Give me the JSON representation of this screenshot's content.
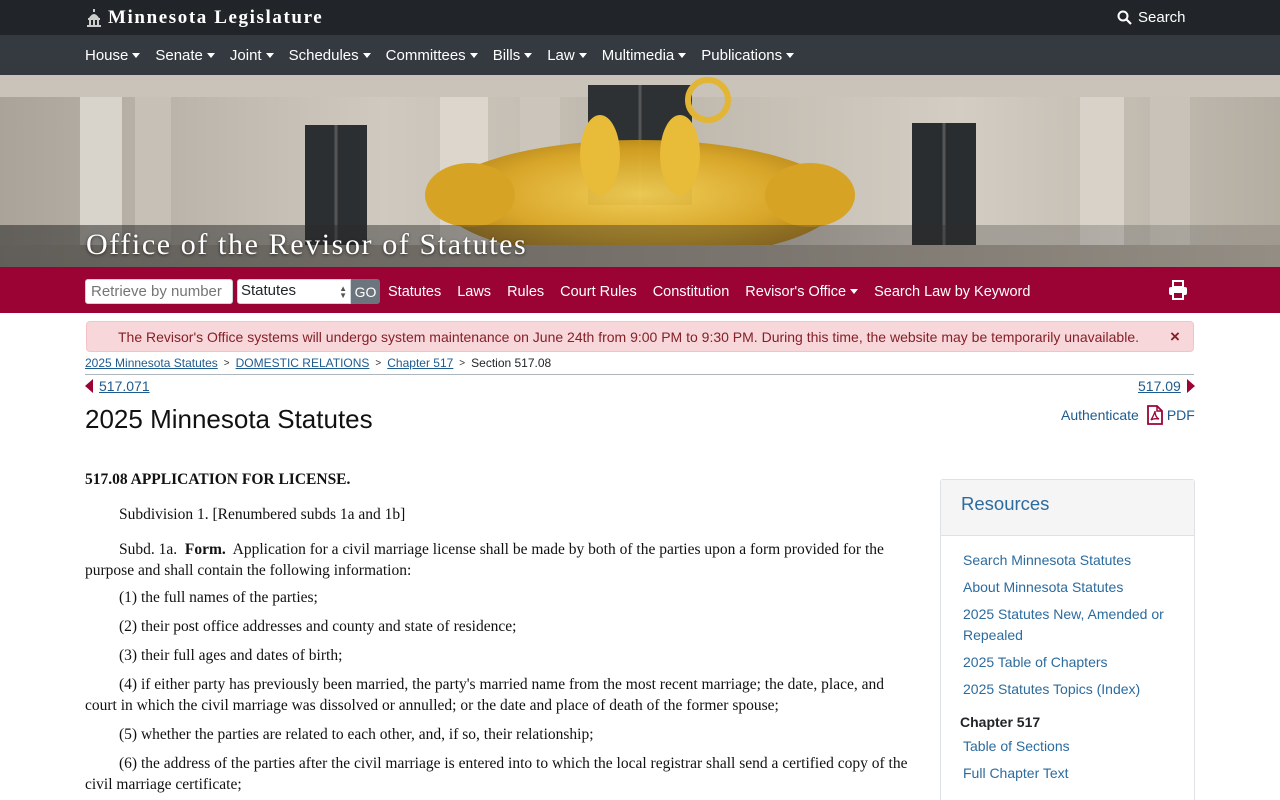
{
  "header": {
    "brand": "Minnesota Legislature",
    "search_label": "Search"
  },
  "nav": {
    "items": [
      "House",
      "Senate",
      "Joint",
      "Schedules",
      "Committees",
      "Bills",
      "Law",
      "Multimedia",
      "Publications"
    ]
  },
  "hero": {
    "title": "Office of the Revisor of Statutes"
  },
  "revisor_bar": {
    "retrieve_placeholder": "Retrieve by number",
    "select_value": "Statutes",
    "go_label": "GO",
    "links": [
      "Statutes",
      "Laws",
      "Rules",
      "Court Rules",
      "Constitution",
      "Revisor's Office",
      "Search Law by Keyword"
    ]
  },
  "alert": {
    "text": "The Revisor's Office systems will undergo system maintenance on June 24th from 9:00 PM to 9:30 PM. During this time, the website may be temporarily unavailable.",
    "close": "×"
  },
  "breadcrumb": {
    "items": [
      "2025 Minnesota Statutes",
      "DOMESTIC RELATIONS",
      "Chapter 517"
    ],
    "current": "Section 517.08"
  },
  "pager": {
    "prev": "517.071",
    "next": "517.09"
  },
  "page": {
    "title": "2025 Minnesota Statutes",
    "authenticate": "Authenticate",
    "pdf": "PDF"
  },
  "statute": {
    "heading": "517.08 APPLICATION FOR LICENSE.",
    "subd1": "Subdivision 1. [Renumbered subds 1a and 1b]",
    "subd1a_prefix": "Subd. 1a.",
    "subd1a_label": "Form.",
    "subd1a_text": "Application for a civil marriage license shall be made by both of the parties upon a form provided for the purpose and shall contain the following information:",
    "items": [
      "(1) the full names of the parties;",
      "(2) their post office addresses and county and state of residence;",
      "(3) their full ages and dates of birth;",
      "(4) if either party has previously been married, the party's married name from the most recent marriage; the date, place, and court in which the civil marriage was dissolved or annulled; or the date and place of death of the former spouse;",
      "(5) whether the parties are related to each other, and, if so, their relationship;",
      "(6) the address of the parties after the civil marriage is entered into to which the local registrar shall send a certified copy of the civil marriage certificate;"
    ]
  },
  "resources": {
    "title": "Resources",
    "links": [
      "Search Minnesota Statutes",
      "About Minnesota Statutes",
      "2025 Statutes New, Amended or Repealed",
      "2025 Table of Chapters",
      "2025 Statutes Topics (Index)"
    ],
    "chapter_heading": "Chapter 517",
    "chapter_links": [
      "Table of Sections",
      "Full Chapter Text"
    ]
  },
  "colors": {
    "revisor_bar": "#9b0335",
    "nav": "#343a40",
    "top": "#212529",
    "link": "#1e5b8f"
  }
}
